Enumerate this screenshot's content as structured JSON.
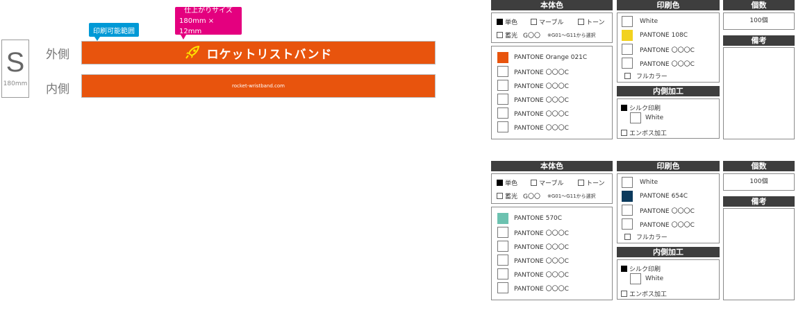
{
  "preview": {
    "size_letter": "S",
    "size_mm": "180mm",
    "outer_label": "外側",
    "inner_label": "内側",
    "print_range_tag": "印刷可能範囲",
    "finish_size_tag_line1": "仕上がりサイズ",
    "finish_size_tag_line2": "180mm × 12mm",
    "band_color": "#e8540d",
    "brand_text": "ロケットリストバンド",
    "inner_url": "rocket-wristband.com"
  },
  "panels": [
    {
      "body_header": "本体色",
      "opt_single": "単色",
      "opt_marble": "マーブル",
      "opt_tone": "トーン",
      "opt_glow": "蓄光",
      "glow_code": "G〇〇",
      "glow_note": "※G01〜G11から選択",
      "body_colors": [
        {
          "label": "PANTONE Orange 021C",
          "swatch": "#e8540d"
        },
        {
          "label": "PANTONE 〇〇〇C",
          "swatch": "#ffffff"
        },
        {
          "label": "PANTONE 〇〇〇C",
          "swatch": "#ffffff"
        },
        {
          "label": "PANTONE 〇〇〇C",
          "swatch": "#ffffff"
        },
        {
          "label": "PANTONE 〇〇〇C",
          "swatch": "#ffffff"
        },
        {
          "label": "PANTONE 〇〇〇C",
          "swatch": "#ffffff"
        }
      ],
      "print_header": "印刷色",
      "print_colors": [
        {
          "label": "White",
          "swatch": "#ffffff"
        },
        {
          "label": "PANTONE 108C",
          "swatch": "#f2d21f"
        },
        {
          "label": "PANTONE 〇〇〇C",
          "swatch": "#ffffff"
        },
        {
          "label": "PANTONE 〇〇〇C",
          "swatch": "#ffffff"
        }
      ],
      "full_color": "フルカラー",
      "inner_header": "内側加工",
      "silk": "シルク印刷",
      "silk_white": "White",
      "emboss": "エンボス加工",
      "qty_header": "個数",
      "qty_value": "100個",
      "notes_header": "備考"
    },
    {
      "body_header": "本体色",
      "opt_single": "単色",
      "opt_marble": "マーブル",
      "opt_tone": "トーン",
      "opt_glow": "蓄光",
      "glow_code": "G〇〇",
      "glow_note": "※G01〜G11から選択",
      "body_colors": [
        {
          "label": "PANTONE 570C",
          "swatch": "#6cc2b0"
        },
        {
          "label": "PANTONE 〇〇〇C",
          "swatch": "#ffffff"
        },
        {
          "label": "PANTONE 〇〇〇C",
          "swatch": "#ffffff"
        },
        {
          "label": "PANTONE 〇〇〇C",
          "swatch": "#ffffff"
        },
        {
          "label": "PANTONE 〇〇〇C",
          "swatch": "#ffffff"
        },
        {
          "label": "PANTONE 〇〇〇C",
          "swatch": "#ffffff"
        }
      ],
      "print_header": "印刷色",
      "print_colors": [
        {
          "label": "White",
          "swatch": "#ffffff"
        },
        {
          "label": "PANTONE 654C",
          "swatch": "#0b3a5d"
        },
        {
          "label": "PANTONE 〇〇〇C",
          "swatch": "#ffffff"
        },
        {
          "label": "PANTONE 〇〇〇C",
          "swatch": "#ffffff"
        }
      ],
      "full_color": "フルカラー",
      "inner_header": "内側加工",
      "silk": "シルク印刷",
      "silk_white": "White",
      "emboss": "エンボス加工",
      "qty_header": "個数",
      "qty_value": "100個",
      "notes_header": "備考"
    }
  ]
}
